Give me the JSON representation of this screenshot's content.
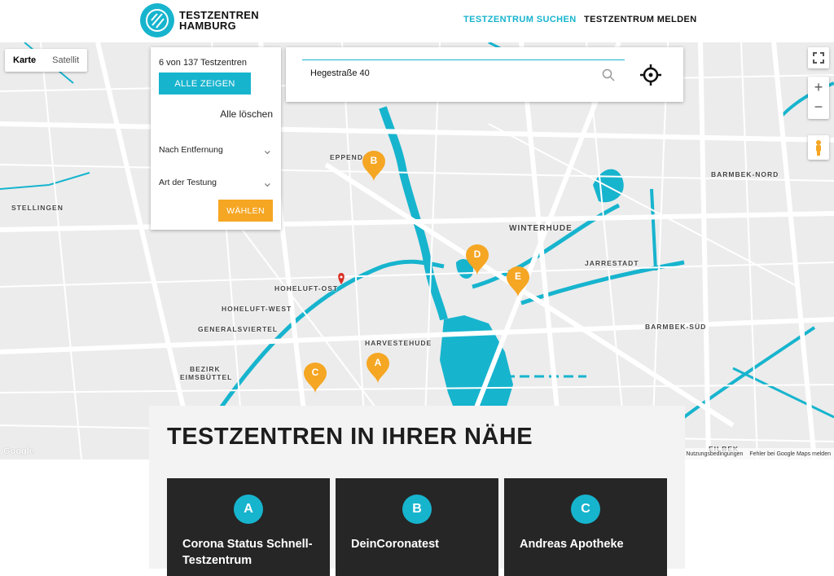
{
  "header": {
    "logo_line1": "TESTZENTREN",
    "logo_line2": "HAMBURG",
    "nav": {
      "search": "TESTZENTRUM SUCHEN",
      "report": "TESTZENTRUM MELDEN"
    }
  },
  "map": {
    "type_map": "Karte",
    "type_satellite": "Satellit",
    "districts": [
      "STELLINGEN",
      "EPPENDORF",
      "WINTERHUDE",
      "JARRESTADT",
      "BARMBEK-NORD",
      "BARMBEK-SÜD",
      "HOHELUFT-OST",
      "HOHELUFT-WEST",
      "GENERALSVIERTEL",
      "HARVESTEHUDE",
      "BEZIRK",
      "EIMSBÜTTEL",
      "EILBEK"
    ],
    "pins": [
      "B",
      "D",
      "E",
      "C",
      "A"
    ],
    "google": "Google",
    "terms": "Nutzungsbedingungen",
    "report_error": "Fehler bei Google Maps melden"
  },
  "filter": {
    "count": "6 von 137 Testzentren",
    "show_all": "ALLE ZEIGEN",
    "clear_all": "Alle löschen",
    "sort": "Nach Entfernung",
    "test_type": "Art der Testung",
    "choose": "WÄHLEN"
  },
  "search": {
    "value": "Hegestraße 40"
  },
  "results": {
    "title": "TESTZENTREN IN IHRER NÄHE",
    "cards": [
      {
        "letter": "A",
        "name": "Corona Status Schnell-Testzentrum"
      },
      {
        "letter": "B",
        "name": "DeinCoronatest"
      },
      {
        "letter": "C",
        "name": "Andreas Apotheke"
      }
    ]
  },
  "colors": {
    "accent": "#17b4ce",
    "pin": "#f5a623",
    "card": "#262626"
  }
}
